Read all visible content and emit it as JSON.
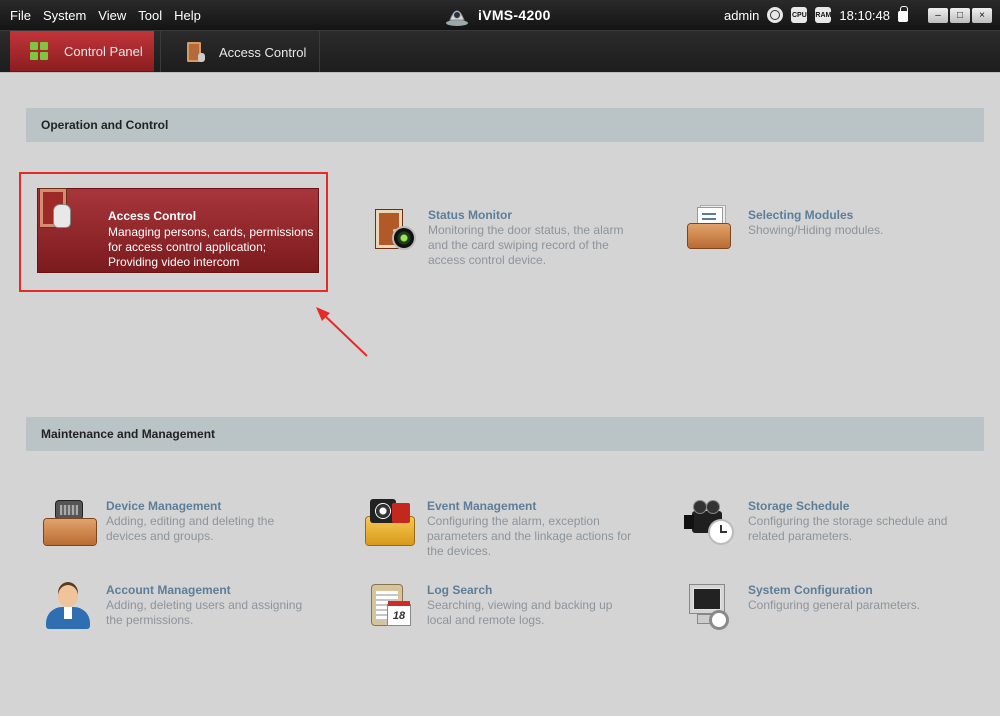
{
  "menu": [
    "File",
    "System",
    "View",
    "Tool",
    "Help"
  ],
  "app_title": "iVMS-4200",
  "status": {
    "user": "admin",
    "ram_label": "RAM",
    "cpu_label": "CPU",
    "time": "18:10:48"
  },
  "window_buttons": {
    "minimize": "–",
    "maximize": "□",
    "close": "×"
  },
  "tabs": [
    {
      "label": "Control Panel",
      "active": true
    },
    {
      "label": "Access Control",
      "active": false
    }
  ],
  "sections": {
    "operation": {
      "header": "Operation and Control",
      "items": [
        {
          "title": "Access Control",
          "desc": "Managing persons, cards, permissions for access control application; Providing video intercom",
          "icon": "door-hand-icon",
          "highlighted": true
        },
        {
          "title": "Status Monitor",
          "desc": "Monitoring the door status, the alarm and the card swiping record of the access control device.",
          "icon": "door-camera-icon"
        },
        {
          "title": "Selecting Modules",
          "desc": "Showing/Hiding modules.",
          "icon": "module-drawer-icon"
        }
      ]
    },
    "maintenance": {
      "header": "Maintenance and Management",
      "items": [
        {
          "title": "Device Management",
          "desc": "Adding, editing and deleting the devices and groups.",
          "icon": "device-drawer-icon"
        },
        {
          "title": "Event Management",
          "desc": "Configuring the alarm, exception parameters and the linkage actions for the devices.",
          "icon": "event-folder-icon"
        },
        {
          "title": "Storage Schedule",
          "desc": "Configuring the storage schedule and related parameters.",
          "icon": "camcorder-clock-icon"
        },
        {
          "title": "Account Management",
          "desc": "Adding, deleting users and assigning the permissions.",
          "icon": "user-icon"
        },
        {
          "title": "Log Search",
          "desc": "Searching, viewing and backing up local and remote logs.",
          "icon": "log-calendar-icon",
          "calendar_day": "18"
        },
        {
          "title": "System Configuration",
          "desc": "Configuring general parameters.",
          "icon": "monitor-gear-icon"
        }
      ]
    }
  },
  "colors": {
    "accent": "#a8363b",
    "highlight_box": "#e52a2a",
    "section_header_bg": "#bac3c6",
    "item_title": "#5d7e99",
    "item_desc": "#8d949a"
  }
}
